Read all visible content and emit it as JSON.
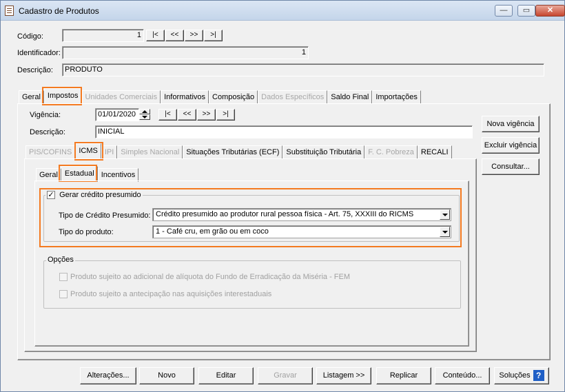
{
  "window": {
    "title": "Cadastro de Produtos",
    "minimize": "—",
    "maximize": "▭",
    "close": "✕"
  },
  "header": {
    "codigo_label": "Código:",
    "codigo_value": "1",
    "identificador_label": "Identificador:",
    "identificador_value": "1",
    "descricao_label": "Descrição:",
    "descricao_value": "PRODUTO",
    "nav": [
      "|<",
      "<<",
      ">>",
      ">|"
    ]
  },
  "main_tabs": [
    "Geral",
    "Impostos",
    "Unidades Comerciais",
    "Informativos",
    "Composição",
    "Dados Específicos",
    "Saldo Final",
    "Importações"
  ],
  "vigencia": {
    "label": "Vigência:",
    "value": "01/01/2020",
    "nav": [
      "|<",
      "<<",
      ">>",
      ">|"
    ],
    "descricao_label": "Descrição:",
    "descricao_value": "INICIAL"
  },
  "side_buttons": {
    "nova": "Nova vigência",
    "excluir": "Excluir vigência",
    "consultar": "Consultar..."
  },
  "impostos_tabs": [
    "PIS/COFINS",
    "ICMS",
    "IPI",
    "Simples Nacional",
    "Situações Tributárias (ECF)",
    "Substituição Tributária",
    "F. C. Pobreza",
    "RECALI"
  ],
  "icms_tabs": [
    "Geral",
    "Estadual",
    "Incentivos"
  ],
  "credito": {
    "checkbox_label": "Gerar crédito presumido",
    "checkbox_mark": "✓",
    "tipo_credito_label": "Tipo de Crédito Presumido:",
    "tipo_credito_value": "Crédito presumido ao produtor rural pessoa física - Art. 75, XXXIII do RICMS",
    "tipo_produto_label": "Tipo do produto:",
    "tipo_produto_value": "1 - Café cru, em grão ou em coco"
  },
  "opcoes": {
    "title": "Opções",
    "fem_label": "Produto sujeito ao adicional de alíquota do Fundo de Erradicação da Miséria - FEM",
    "antecipacao_label": "Produto sujeito a antecipação nas aquisições interestaduais"
  },
  "footer": {
    "alteracoes": "Alterações...",
    "novo": "Novo",
    "editar": "Editar",
    "gravar": "Gravar",
    "listagem": "Listagem >>",
    "replicar": "Replicar",
    "conteudo": "Conteúdo...",
    "solucoes": "Soluções",
    "help_glyph": "?"
  },
  "colors": {
    "highlight": "#f47a20",
    "titlebar": "#c4d5ea",
    "help": "#1f5fc6"
  }
}
